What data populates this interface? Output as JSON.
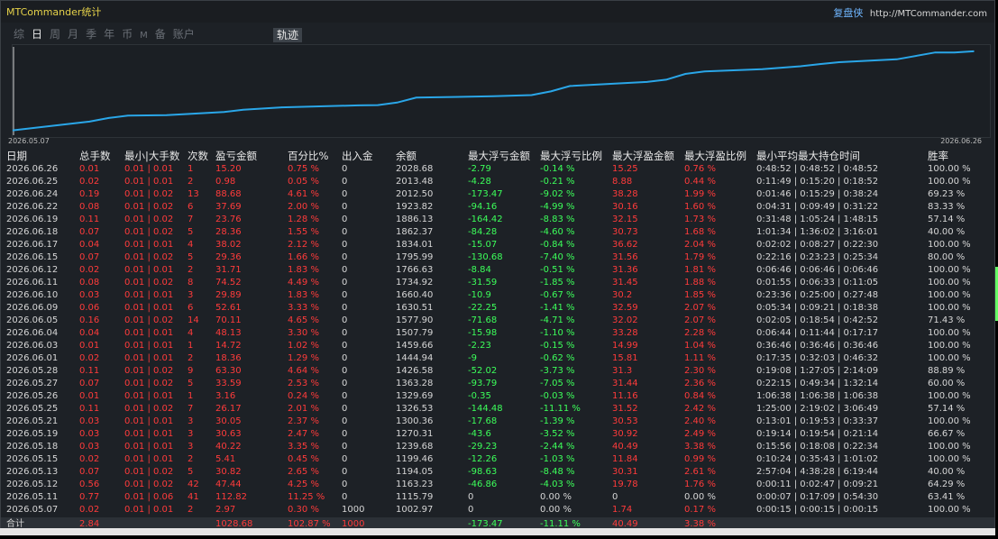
{
  "app": {
    "title": "MTCommander统计",
    "brand_name": "复盘侠",
    "brand_url": "http://MTCommander.com"
  },
  "tabs": [
    {
      "label": "综",
      "active": false
    },
    {
      "label": "日",
      "active": true
    },
    {
      "label": "周",
      "active": false
    },
    {
      "label": "月",
      "active": false
    },
    {
      "label": "季",
      "active": false
    },
    {
      "label": "年",
      "active": false
    },
    {
      "label": "币",
      "active": false
    },
    {
      "label": "M",
      "active": false
    },
    {
      "label": "备",
      "active": false
    },
    {
      "label": "账户",
      "active": false
    }
  ],
  "track_tab": "轨迹",
  "chart_data": {
    "type": "line",
    "x_start": "2026.05.07",
    "x_end": "2026.06.26",
    "x": [
      "2026.05.07",
      "2026.05.11",
      "2026.05.12",
      "2026.05.13",
      "2026.05.15",
      "2026.05.18",
      "2026.05.19",
      "2026.05.21",
      "2026.05.25",
      "2026.05.26",
      "2026.05.27",
      "2026.05.28",
      "2026.06.01",
      "2026.06.03",
      "2026.06.04",
      "2026.06.05",
      "2026.06.09",
      "2026.06.10",
      "2026.06.11",
      "2026.06.12",
      "2026.06.15",
      "2026.06.17",
      "2026.06.18",
      "2026.06.19",
      "2026.06.22",
      "2026.06.24",
      "2026.06.25",
      "2026.06.26"
    ],
    "values": [
      1002.97,
      1115.79,
      1163.23,
      1194.05,
      1199.46,
      1239.68,
      1270.31,
      1300.36,
      1326.53,
      1329.69,
      1363.28,
      1426.58,
      1444.94,
      1459.66,
      1507.79,
      1577.9,
      1630.51,
      1660.4,
      1734.92,
      1766.63,
      1795.99,
      1834.01,
      1862.37,
      1886.13,
      1923.82,
      2012.5,
      2013.48,
      2028.68
    ],
    "color": "#2aa6e8"
  },
  "table": {
    "headers": {
      "date": "日期",
      "lots": "总手数",
      "minmax": "最小|大手数",
      "count": "次数",
      "pl": "盈亏金额",
      "pct": "百分比%",
      "io": "出入金",
      "balance": "余额",
      "mfl": "最大浮亏金额",
      "mflr": "最大浮亏比例",
      "mfp": "最大浮盈金额",
      "mfpr": "最大浮盈比例",
      "hold": "最小平均最大持仓时间",
      "win": "胜率"
    },
    "rows": [
      [
        "2026.06.26",
        "0.01",
        "0.01 | 0.01",
        "1",
        "15.20",
        "0.75 %",
        "0",
        "2028.68",
        "-2.79",
        "-0.14 %",
        "15.25",
        "0.76 %",
        "0:48:52 | 0:48:52 | 0:48:52",
        "100.00 %"
      ],
      [
        "2026.06.25",
        "0.02",
        "0.01 | 0.01",
        "2",
        "0.98",
        "0.05 %",
        "0",
        "2013.48",
        "-4.28",
        "-0.21 %",
        "8.88",
        "0.44 %",
        "0:11:49 | 0:15:20 | 0:18:52",
        "100.00 %"
      ],
      [
        "2026.06.24",
        "0.19",
        "0.01 | 0.02",
        "13",
        "88.68",
        "4.61 %",
        "0",
        "2012.50",
        "-173.47",
        "-9.02 %",
        "38.28",
        "1.99 %",
        "0:01:46 | 0:15:29 | 0:38:24",
        "69.23 %"
      ],
      [
        "2026.06.22",
        "0.08",
        "0.01 | 0.02",
        "6",
        "37.69",
        "2.00 %",
        "0",
        "1923.82",
        "-94.16",
        "-4.99 %",
        "30.16",
        "1.60 %",
        "0:04:31 | 0:09:49 | 0:31:22",
        "83.33 %"
      ],
      [
        "2026.06.19",
        "0.11",
        "0.01 | 0.02",
        "7",
        "23.76",
        "1.28 %",
        "0",
        "1886.13",
        "-164.42",
        "-8.83 %",
        "32.15",
        "1.73 %",
        "0:31:48 | 1:05:24 | 1:48:15",
        "57.14 %"
      ],
      [
        "2026.06.18",
        "0.07",
        "0.01 | 0.02",
        "5",
        "28.36",
        "1.55 %",
        "0",
        "1862.37",
        "-84.28",
        "-4.60 %",
        "30.73",
        "1.68 %",
        "1:01:34 | 1:36:02 | 3:16:01",
        "40.00 %"
      ],
      [
        "2026.06.17",
        "0.04",
        "0.01 | 0.01",
        "4",
        "38.02",
        "2.12 %",
        "0",
        "1834.01",
        "-15.07",
        "-0.84 %",
        "36.62",
        "2.04 %",
        "0:02:02 | 0:08:27 | 0:22:30",
        "100.00 %"
      ],
      [
        "2026.06.15",
        "0.07",
        "0.01 | 0.02",
        "5",
        "29.36",
        "1.66 %",
        "0",
        "1795.99",
        "-130.68",
        "-7.40 %",
        "31.56",
        "1.79 %",
        "0:22:16 | 0:23:23 | 0:25:34",
        "80.00 %"
      ],
      [
        "2026.06.12",
        "0.02",
        "0.01 | 0.01",
        "2",
        "31.71",
        "1.83 %",
        "0",
        "1766.63",
        "-8.84",
        "-0.51 %",
        "31.36",
        "1.81 %",
        "0:06:46 | 0:06:46 | 0:06:46",
        "100.00 %"
      ],
      [
        "2026.06.11",
        "0.08",
        "0.01 | 0.02",
        "8",
        "74.52",
        "4.49 %",
        "0",
        "1734.92",
        "-31.59",
        "-1.85 %",
        "31.45",
        "1.88 %",
        "0:01:55 | 0:06:33 | 0:11:05",
        "100.00 %"
      ],
      [
        "2026.06.10",
        "0.03",
        "0.01 | 0.01",
        "3",
        "29.89",
        "1.83 %",
        "0",
        "1660.40",
        "-10.9",
        "-0.67 %",
        "30.2",
        "1.85 %",
        "0:23:36 | 0:25:00 | 0:27:48",
        "100.00 %"
      ],
      [
        "2026.06.09",
        "0.06",
        "0.01 | 0.01",
        "6",
        "52.61",
        "3.33 %",
        "0",
        "1630.51",
        "-22.25",
        "-1.41 %",
        "32.59",
        "2.07 %",
        "0:05:34 | 0:09:21 | 0:18:38",
        "100.00 %"
      ],
      [
        "2026.06.05",
        "0.16",
        "0.01 | 0.02",
        "14",
        "70.11",
        "4.65 %",
        "0",
        "1577.90",
        "-71.68",
        "-4.71 %",
        "32.02",
        "2.07 %",
        "0:02:05 | 0:18:54 | 0:42:52",
        "71.43 %"
      ],
      [
        "2026.06.04",
        "0.04",
        "0.01 | 0.01",
        "4",
        "48.13",
        "3.30 %",
        "0",
        "1507.79",
        "-15.98",
        "-1.10 %",
        "33.28",
        "2.28 %",
        "0:06:44 | 0:11:44 | 0:17:17",
        "100.00 %"
      ],
      [
        "2026.06.03",
        "0.01",
        "0.01 | 0.01",
        "1",
        "14.72",
        "1.02 %",
        "0",
        "1459.66",
        "-2.23",
        "-0.15 %",
        "14.99",
        "1.04 %",
        "0:36:46 | 0:36:46 | 0:36:46",
        "100.00 %"
      ],
      [
        "2026.06.01",
        "0.02",
        "0.01 | 0.01",
        "2",
        "18.36",
        "1.29 %",
        "0",
        "1444.94",
        "-9",
        "-0.62 %",
        "15.81",
        "1.11 %",
        "0:17:35 | 0:32:03 | 0:46:32",
        "100.00 %"
      ],
      [
        "2026.05.28",
        "0.11",
        "0.01 | 0.02",
        "9",
        "63.30",
        "4.64 %",
        "0",
        "1426.58",
        "-52.02",
        "-3.73 %",
        "31.3",
        "2.30 %",
        "0:19:08 | 1:27:05 | 2:14:09",
        "88.89 %"
      ],
      [
        "2026.05.27",
        "0.07",
        "0.01 | 0.02",
        "5",
        "33.59",
        "2.53 %",
        "0",
        "1363.28",
        "-93.79",
        "-7.05 %",
        "31.44",
        "2.36 %",
        "0:22:15 | 0:49:34 | 1:32:14",
        "60.00 %"
      ],
      [
        "2026.05.26",
        "0.01",
        "0.01 | 0.01",
        "1",
        "3.16",
        "0.24 %",
        "0",
        "1329.69",
        "-0.35",
        "-0.03 %",
        "11.16",
        "0.84 %",
        "1:06:38 | 1:06:38 | 1:06:38",
        "100.00 %"
      ],
      [
        "2026.05.25",
        "0.11",
        "0.01 | 0.02",
        "7",
        "26.17",
        "2.01 %",
        "0",
        "1326.53",
        "-144.48",
        "-11.11 %",
        "31.52",
        "2.42 %",
        "1:25:00 | 2:19:02 | 3:06:49",
        "57.14 %"
      ],
      [
        "2026.05.21",
        "0.03",
        "0.01 | 0.01",
        "3",
        "30.05",
        "2.37 %",
        "0",
        "1300.36",
        "-17.68",
        "-1.39 %",
        "30.53",
        "2.40 %",
        "0:13:01 | 0:19:53 | 0:33:37",
        "100.00 %"
      ],
      [
        "2026.05.19",
        "0.03",
        "0.01 | 0.01",
        "3",
        "30.63",
        "2.47 %",
        "0",
        "1270.31",
        "-43.6",
        "-3.52 %",
        "30.92",
        "2.49 %",
        "0:19:14 | 0:19:54 | 0:21:14",
        "66.67 %"
      ],
      [
        "2026.05.18",
        "0.03",
        "0.01 | 0.01",
        "3",
        "40.22",
        "3.35 %",
        "0",
        "1239.68",
        "-29.23",
        "-2.44 %",
        "40.49",
        "3.38 %",
        "0:15:56 | 0:18:08 | 0:22:34",
        "100.00 %"
      ],
      [
        "2026.05.15",
        "0.02",
        "0.01 | 0.01",
        "2",
        "5.41",
        "0.45 %",
        "0",
        "1199.46",
        "-12.26",
        "-1.03 %",
        "11.84",
        "0.99 %",
        "0:10:24 | 0:35:43 | 1:01:02",
        "100.00 %"
      ],
      [
        "2026.05.13",
        "0.07",
        "0.01 | 0.02",
        "5",
        "30.82",
        "2.65 %",
        "0",
        "1194.05",
        "-98.63",
        "-8.48 %",
        "30.31",
        "2.61 %",
        "2:57:04 | 4:38:28 | 6:19:44",
        "40.00 %"
      ],
      [
        "2026.05.12",
        "0.56",
        "0.01 | 0.02",
        "42",
        "47.44",
        "4.25 %",
        "0",
        "1163.23",
        "-46.86",
        "-4.03 %",
        "19.78",
        "1.76 %",
        "0:00:11 | 0:02:47 | 0:09:21",
        "64.29 %"
      ],
      [
        "2026.05.11",
        "0.77",
        "0.01 | 0.06",
        "41",
        "112.82",
        "11.25 %",
        "0",
        "1115.79",
        "0",
        "0.00 %",
        "0",
        "0.00 %",
        "0:00:07 | 0:17:09 | 0:54:30",
        "63.41 %"
      ],
      [
        "2026.05.07",
        "0.02",
        "0.01 | 0.01",
        "2",
        "2.97",
        "0.30 %",
        "1000",
        "1002.97",
        "0",
        "0.00 %",
        "1.74",
        "0.17 %",
        "0:00:15 | 0:00:15 | 0:00:15",
        "100.00 %"
      ]
    ],
    "total": {
      "label": "合计",
      "lots": "2.84",
      "pl": "1028.68",
      "pct": "102.87 %",
      "io": "1000",
      "mfl": "-173.47",
      "mflr": "-11.11 %",
      "mfp": "40.49",
      "mfpr": "3.38 %"
    }
  },
  "colors": {
    "profit": "#ff3b3b",
    "loss": "#3cff5a",
    "line": "#2aa6e8",
    "title": "#e6d24a"
  }
}
